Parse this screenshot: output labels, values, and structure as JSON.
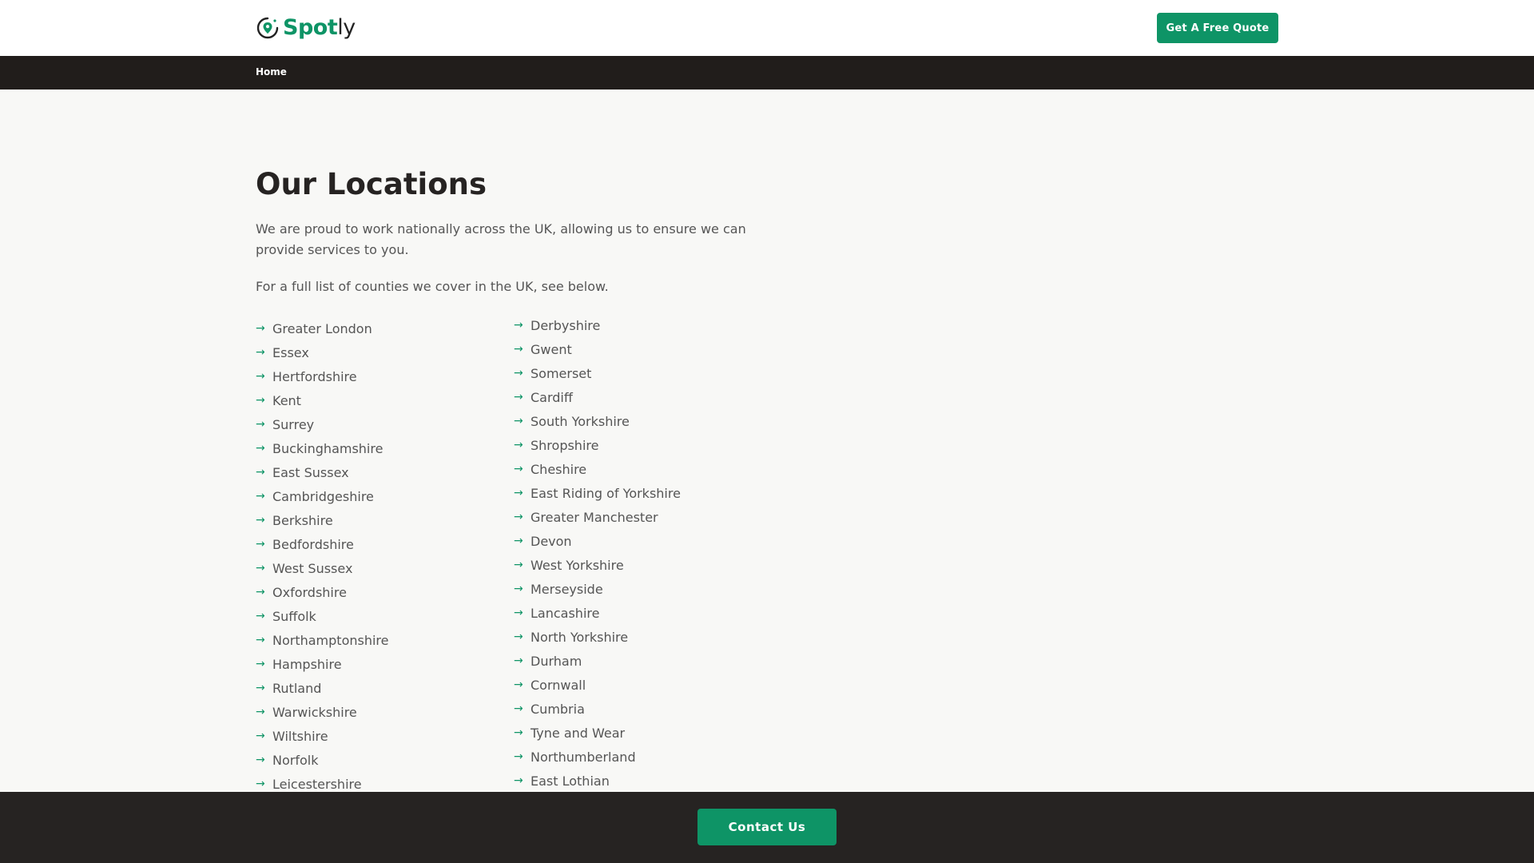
{
  "header": {
    "logo": {
      "text_strong": "Spot",
      "text_light": "ly"
    },
    "quote_button": "Get A Free Quote"
  },
  "nav": {
    "home": "Home"
  },
  "main": {
    "title": "Our Locations",
    "intro": "We are proud to work nationally across the UK, allowing us to ensure we can provide services to you.",
    "intro2": "For a full list of counties we cover in the UK, see below.",
    "counties_col1": [
      "Greater London",
      "Essex",
      "Hertfordshire",
      "Kent",
      "Surrey",
      "Buckinghamshire",
      "East Sussex",
      "Cambridgeshire",
      "Berkshire",
      "Bedfordshire",
      "West Sussex",
      "Oxfordshire",
      "Suffolk",
      "Northamptonshire",
      "Hampshire",
      "Rutland",
      "Warwickshire",
      "Wiltshire",
      "Norfolk",
      "Leicestershire"
    ],
    "counties_col2": [
      "Derbyshire",
      "Gwent",
      "Somerset",
      "Cardiff",
      "South Yorkshire",
      "Shropshire",
      "Cheshire",
      "East Riding of Yorkshire",
      "Greater Manchester",
      "Devon",
      "West Yorkshire",
      "Merseyside",
      "Lancashire",
      "North Yorkshire",
      "Durham",
      "Cornwall",
      "Cumbria",
      "Tyne and Wear",
      "Northumberland",
      "East Lothian"
    ]
  },
  "footer": {
    "contact_button": "Contact Us"
  },
  "colors": {
    "brand_green": "#0e9466",
    "dark_bar": "#211d1b",
    "page_bg": "#f8f8f6"
  },
  "icons": {
    "list_marker": "arrow-right-icon",
    "logo_mark": "location-pin-icon"
  }
}
